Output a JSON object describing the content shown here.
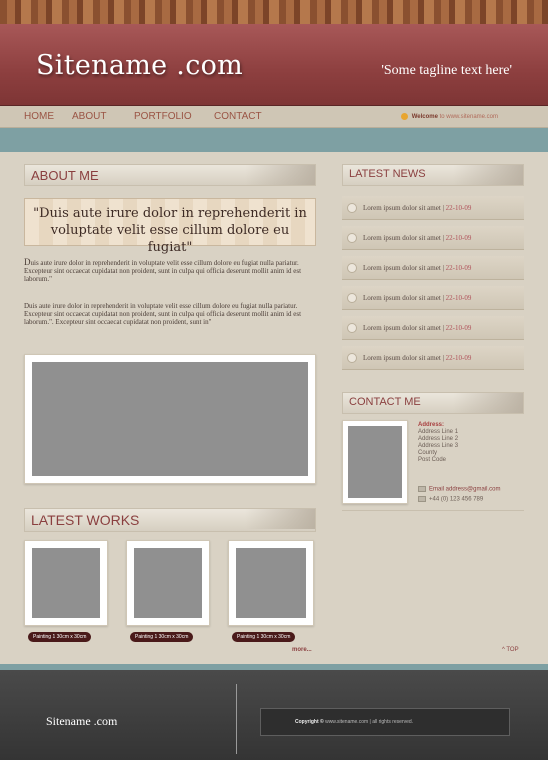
{
  "site": {
    "name": "Sitename .com",
    "tagline": "'Some tagline text here'"
  },
  "nav": {
    "items": [
      "HOME",
      "ABOUT",
      "PORTFOLIO",
      "CONTACT"
    ],
    "welcome_label": "Welcome",
    "welcome_rest": "to www.sitename.com"
  },
  "about": {
    "heading": "ABOUT ME",
    "quote": "\"Duis aute irure dolor in reprehenderit in voluptate velit esse cillum dolore eu fugiat\"",
    "dropcap": "D",
    "p1": "uis aute irure dolor in reprehenderit in voluptate velit esse cillum dolore eu fugiat nulla pariatur. Excepteur sint occaecat cupidatat non proident, sunt in culpa qui officia deserunt mollit anim id est laborum.\"",
    "p2": "Duis aute irure dolor in reprehenderit in voluptate velit esse cillum dolore eu fugiat nulla pariatur. Excepteur sint occaecat cupidatat non proident, sunt in culpa qui officia deserunt mollit anim id est laborum.\". Excepteur sint occaecat cupidatat non proident, sunt in\""
  },
  "works": {
    "heading": "LATEST WORKS",
    "labels": [
      "Painting 1 30cm x 30cm",
      "Painting 1 30cm x 30cm",
      "Painting 1 30cm x 30cm"
    ],
    "more": "more...",
    "top": "^ TOP"
  },
  "news": {
    "heading": "LATEST NEWS",
    "items": [
      {
        "text": "Lorem ipsum dolor sit amet |",
        "date": "22-10-09"
      },
      {
        "text": "Lorem ipsum dolor sit amet |",
        "date": "22-10-09"
      },
      {
        "text": "Lorem ipsum dolor sit amet |",
        "date": "22-10-09"
      },
      {
        "text": "Lorem ipsum dolor sit amet |",
        "date": "22-10-09"
      },
      {
        "text": "Lorem ipsum dolor sit amet |",
        "date": "22-10-09"
      },
      {
        "text": "Lorem ipsum dolor sit amet |",
        "date": "22-10-09"
      }
    ]
  },
  "contact": {
    "heading": "CONTACT ME",
    "address_title": "Address:",
    "address_lines": [
      "Address Line 1",
      "Address Line 2",
      "Address Line 3",
      "County",
      "Post Code"
    ],
    "email": "Email address@gmail.com",
    "phone": "+44 (0) 123 456 789"
  },
  "footer": {
    "name": "Sitename .com",
    "copyright_label": "Copyright ©",
    "copyright_rest": "www.sitename.com | all rights reserved."
  },
  "colors": {
    "header": "#8d3f3f",
    "accent_teal": "#7ea0a3",
    "background": "#d9d2c4",
    "footer": "#3c3c3c"
  }
}
